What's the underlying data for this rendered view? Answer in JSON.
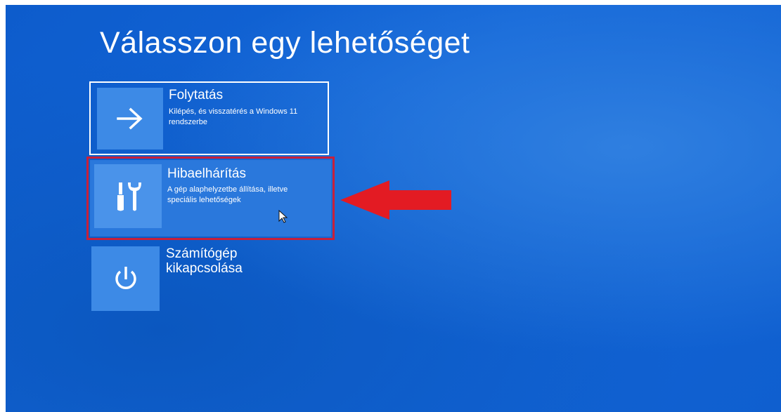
{
  "page": {
    "title": "Válasszon egy lehetőséget"
  },
  "options": [
    {
      "id": "continue",
      "title": "Folytatás",
      "description": "Kilépés, és visszatérés a Windows 11 rendszerbe",
      "icon": "arrow-right-icon"
    },
    {
      "id": "troubleshoot",
      "title": "Hibaelhárítás",
      "description": "A gép alaphelyzetbe állítása, illetve speciális lehetőségek",
      "icon": "tools-icon",
      "highlighted": true
    },
    {
      "id": "shutdown",
      "title": "Számítógép kikapcsolása",
      "description": "",
      "icon": "power-icon"
    }
  ],
  "annotation": {
    "arrow_color": "#e31b23",
    "highlight_color": "#c8203a"
  },
  "colors": {
    "background": "#1262d4",
    "tile": "#3d8ae6",
    "text": "#ffffff"
  }
}
